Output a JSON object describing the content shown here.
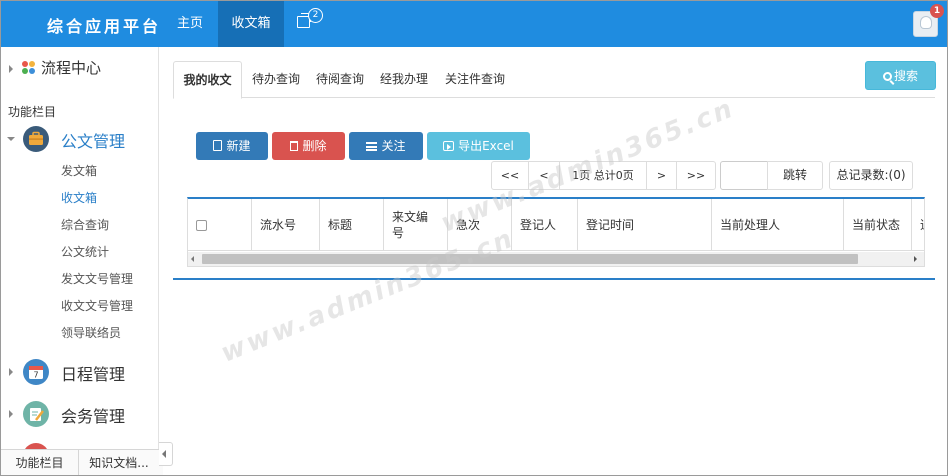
{
  "header": {
    "brand": "综合应用平台",
    "nav": [
      {
        "label": "主页"
      },
      {
        "label": "收文箱"
      }
    ],
    "message_count": "2",
    "notification_count": "1"
  },
  "sidebar": {
    "flow_center": "流程中心",
    "section_label": "功能栏目",
    "groups": [
      {
        "label": "公文管理",
        "icon": "briefcase-icon",
        "color": "#3a5b7a"
      },
      {
        "label": "日程管理",
        "icon": "calendar-icon",
        "color": "#3f87c6"
      },
      {
        "label": "会务管理",
        "icon": "edit-icon",
        "color": "#6fb4a7"
      }
    ],
    "calendar_day": "7",
    "items": [
      {
        "label": "发文箱"
      },
      {
        "label": "收文箱"
      },
      {
        "label": "综合查询"
      },
      {
        "label": "公文统计"
      },
      {
        "label": "发文文号管理"
      },
      {
        "label": "收文文号管理"
      },
      {
        "label": "领导联络员"
      }
    ],
    "bottom_tabs": [
      {
        "label": "功能栏目"
      },
      {
        "label": "知识文档..."
      }
    ]
  },
  "main": {
    "tabs": [
      {
        "label": "我的收文"
      },
      {
        "label": "待办查询"
      },
      {
        "label": "待阅查询"
      },
      {
        "label": "经我办理"
      },
      {
        "label": "关注件查询"
      }
    ],
    "search_label": "搜索",
    "toolbar": {
      "new_label": "新建",
      "delete_label": "删除",
      "follow_label": "关注",
      "export_label": "导出Excel"
    },
    "pager": {
      "first": "<<",
      "prev": "<",
      "info": "1页 总计0页",
      "next": ">",
      "last": ">>",
      "jump_value": "",
      "jump_label": "跳转",
      "total": "总记录数:(0)"
    },
    "columns": [
      {
        "label": ""
      },
      {
        "label": "流水号"
      },
      {
        "label": "标题"
      },
      {
        "label": "来文编号"
      },
      {
        "label": "急次"
      },
      {
        "label": "登记人"
      },
      {
        "label": "登记时间"
      },
      {
        "label": "当前处理人"
      },
      {
        "label": "当前状态"
      },
      {
        "label": "追"
      }
    ]
  },
  "watermark": "www.admin365.cn",
  "colors": {
    "topbar": "#1f8ce0",
    "active_nav": "#166fb6",
    "primary": "#337ab7",
    "danger": "#d9534f",
    "info": "#5bc0de",
    "link": "#2a7fc8"
  }
}
